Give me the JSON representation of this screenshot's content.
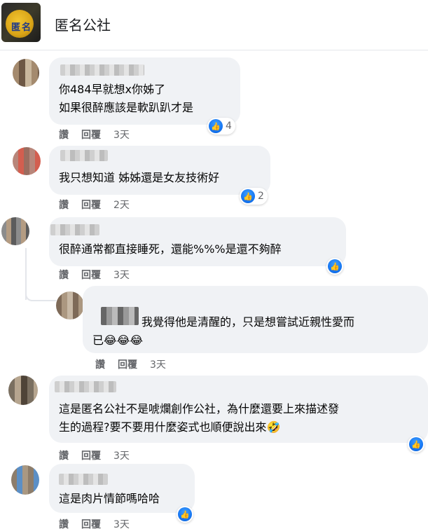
{
  "group": {
    "name": "匿名公社",
    "avatar_text": "匿名"
  },
  "icons": {
    "like": "thumbs-up-icon"
  },
  "colors": {
    "like_blue": "#1877f2",
    "bubble": "#f0f2f5",
    "meta_gray": "#65676b"
  },
  "labels": {
    "like": "讚",
    "reply": "回覆"
  },
  "comments": [
    {
      "lines": [
        "你484早就想x你姊了",
        "如果很醉應該是軟趴趴才是"
      ],
      "likes": "4",
      "time": "3天"
    },
    {
      "lines": [
        "我只想知道 姊姊還是女友技術好"
      ],
      "likes": "2",
      "time": "2天"
    },
    {
      "lines": [
        "很醉通常都直接睡死，還能%%%是還不夠醉"
      ],
      "likes": "",
      "time": "3天"
    },
    {
      "lines": [
        "我覺得他是清醒的，只是想嘗試近親性愛而",
        "已😂😂😂"
      ],
      "likes": "",
      "time": "3天"
    },
    {
      "lines": [
        "這是匿名公社不是唬爛創作公社，為什麼還要上來描述發",
        "生的過程?要不要用什麼姿式也順便說出來🤣"
      ],
      "likes": "",
      "time": "3天"
    },
    {
      "lines": [
        "這是肉片情節嗎哈哈"
      ],
      "likes": "",
      "time": "3天"
    }
  ]
}
